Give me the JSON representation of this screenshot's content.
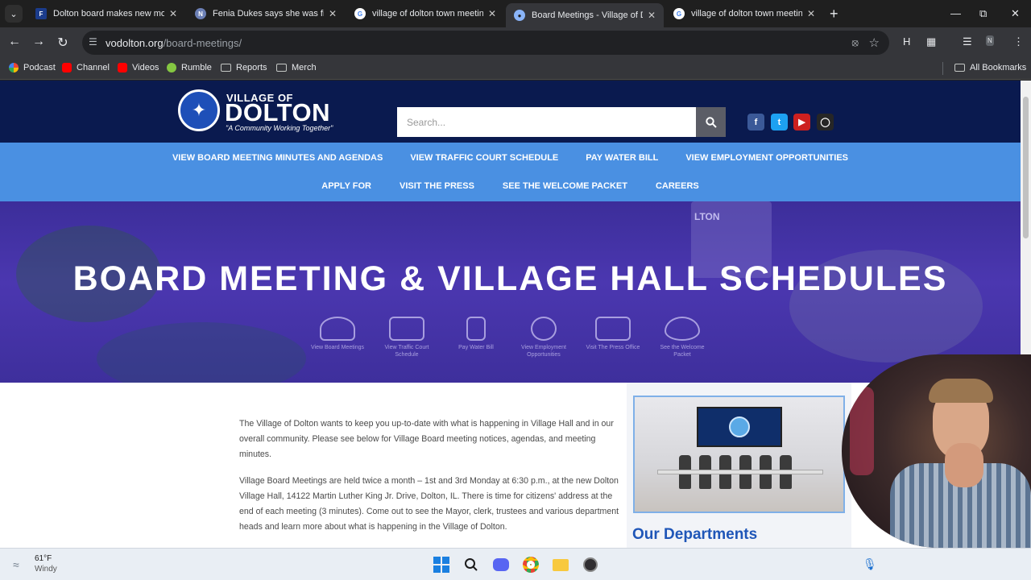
{
  "browser": {
    "tabs": [
      {
        "title": "Dolton board makes new move",
        "favicon": "fox-news-icon",
        "active": false
      },
      {
        "title": "Fenia Dukes says she was fired",
        "favicon": "news-site-icon",
        "active": false
      },
      {
        "title": "village of dolton town meeting",
        "favicon": "google-icon",
        "active": false
      },
      {
        "title": "Board Meetings - Village of Dolton",
        "favicon": "globe-icon",
        "active": true
      },
      {
        "title": "village of dolton town meeting",
        "favicon": "google-icon",
        "active": false
      }
    ],
    "address": {
      "domain": "vodolton.org",
      "path": "/board-meetings/"
    },
    "bookmarks": [
      {
        "label": "Podcast",
        "icon": "podcast-icon"
      },
      {
        "label": "Channel",
        "icon": "youtube-icon"
      },
      {
        "label": "Videos",
        "icon": "youtube-icon"
      },
      {
        "label": "Rumble",
        "icon": "rumble-icon"
      },
      {
        "label": "Reports",
        "icon": "folder-icon"
      },
      {
        "label": "Merch",
        "icon": "folder-icon"
      }
    ],
    "all_bookmarks": "All Bookmarks"
  },
  "site": {
    "logo": {
      "top": "VILLAGE OF",
      "main": "DOLTON",
      "tagline": "\"A Community Working Together\""
    },
    "search": {
      "placeholder": "Search..."
    },
    "social": [
      "facebook-icon",
      "twitter-icon",
      "youtube-icon",
      "instagram-icon"
    ],
    "nav_row1": [
      "VIEW BOARD MEETING MINUTES AND AGENDAS",
      "VIEW TRAFFIC COURT SCHEDULE",
      "PAY WATER BILL",
      "VIEW EMPLOYMENT OPPORTUNITIES"
    ],
    "nav_row2": [
      "APPLY FOR",
      "VISIT THE PRESS",
      "SEE THE WELCOME PACKET",
      "CAREERS"
    ],
    "hero": {
      "title": "BOARD MEETING & VILLAGE HALL SCHEDULES",
      "tower_text": "LTON",
      "icons": [
        "View Board Meetings",
        "View Traffic Court Schedule",
        "Pay Water Bill",
        "View Employment Opportunities",
        "Visit The Press Office",
        "See the Welcome Packet"
      ]
    },
    "intro": [
      "The Village of Dolton wants to keep you up-to-date with what is happening in Village Hall and in our overall community. Please see below for Village Board meeting notices, agendas, and meeting minutes.",
      "Village Board Meetings are held twice a month – 1st and 3rd Monday at 6:30 p.m.,  at the new Dolton Village Hall, 14122 Martin Luther King Jr. Drive, Dolton, IL. There is time for citizens' address at the end of each meeting (3 minutes).  Come out to see the Mayor, clerk, trustees and various department heads and learn more about what is happening in the Village of Dolton."
    ],
    "departments_title": "Our Departments"
  },
  "taskbar": {
    "weather": {
      "temp": "61°F",
      "condition": "Windy"
    },
    "apps": [
      "start-icon",
      "search-icon",
      "discord-icon",
      "chrome-icon",
      "file-explorer-icon",
      "obs-icon"
    ]
  },
  "colors": {
    "header_navy": "#0a1a4f",
    "nav_blue": "#4a90e2",
    "hero_purple": "#4b37b0",
    "dept_blue": "#1f56b8"
  }
}
